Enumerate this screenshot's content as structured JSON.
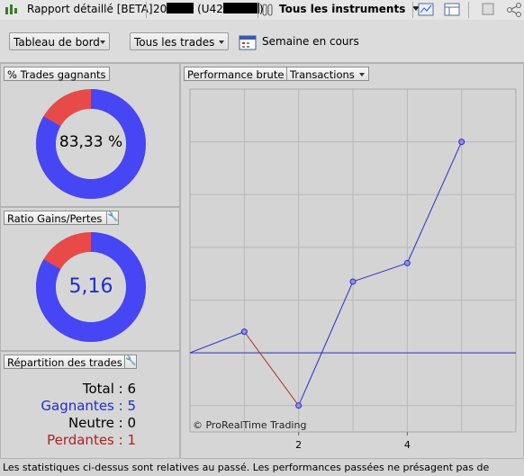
{
  "titlebar": {
    "title": "Rapport détaillé [BETA]",
    "account_prefix": "20",
    "account_mid": "(U42",
    "account_suffix": ")",
    "instrument": "Tous les instruments"
  },
  "toolbar": {
    "dashboard_label": "Tableau de bord",
    "trades_label": "Tous les trades",
    "period_label": "Semaine en cours"
  },
  "win_panel": {
    "title": "% Trades gagnants",
    "value": "83,33 %",
    "fraction": 0.8333
  },
  "ratio_panel": {
    "title": "Ratio Gains/Pertes",
    "value": "5,16",
    "fraction": 0.8333
  },
  "distribution": {
    "title": "Répartition des trades",
    "total": "Total : 6",
    "winners": "Gagnantes : 5",
    "neutral": "Neutre : 0",
    "losers": "Perdantes : 1"
  },
  "chart_panel": {
    "tab_performance": "Performance brute",
    "tab_transactions": "Transactions"
  },
  "chart_data": {
    "type": "line",
    "x": [
      0,
      1,
      2,
      3,
      4,
      5
    ],
    "y": [
      0,
      0.4,
      -1.0,
      1.35,
      1.7,
      4.0
    ],
    "xticks": [
      "2",
      "4"
    ],
    "xtick_values": [
      2,
      4
    ],
    "xlim": [
      0,
      6
    ],
    "ylim": [
      -1.5,
      5.0
    ],
    "grid": true,
    "watermark": "© ProRealTime Trading",
    "colors": {
      "gain": "#2a2ad0",
      "loss": "#b03030",
      "baseline": "#3333cc"
    }
  },
  "colors": {
    "donut_main": "#4646f5",
    "donut_minor": "#e84a4a",
    "win_text": "#1e2ed0",
    "lose_text": "#b02020"
  },
  "footer": "Les statistiques ci-dessus sont relatives au passé. Les performances passées ne présagent pas de"
}
